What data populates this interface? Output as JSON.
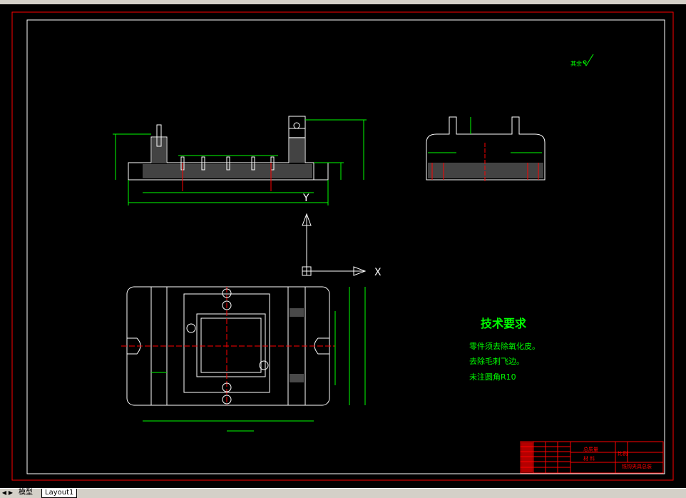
{
  "drawing": {
    "roughness_note": "其余",
    "tech_requirements": {
      "title": "技术要求",
      "lines": [
        "零件须去除氧化皮。",
        "去除毛刺飞边。",
        "未注圆角R10"
      ]
    },
    "ucs": {
      "y_label": "Y",
      "x_label": "X"
    },
    "title_block": {
      "design_label": "总质量",
      "material_label": "材 料",
      "scale_label": "比例",
      "part_name": "铣钩夹具总装"
    }
  },
  "tabs": [
    {
      "label": "模型",
      "active": false
    },
    {
      "label": "Layout1",
      "active": true
    }
  ],
  "colors": {
    "background": "#000000",
    "geometry": "#ffffff",
    "dimension": "#00ff00",
    "border": "#ff0000",
    "centerline": "#ff0000"
  }
}
